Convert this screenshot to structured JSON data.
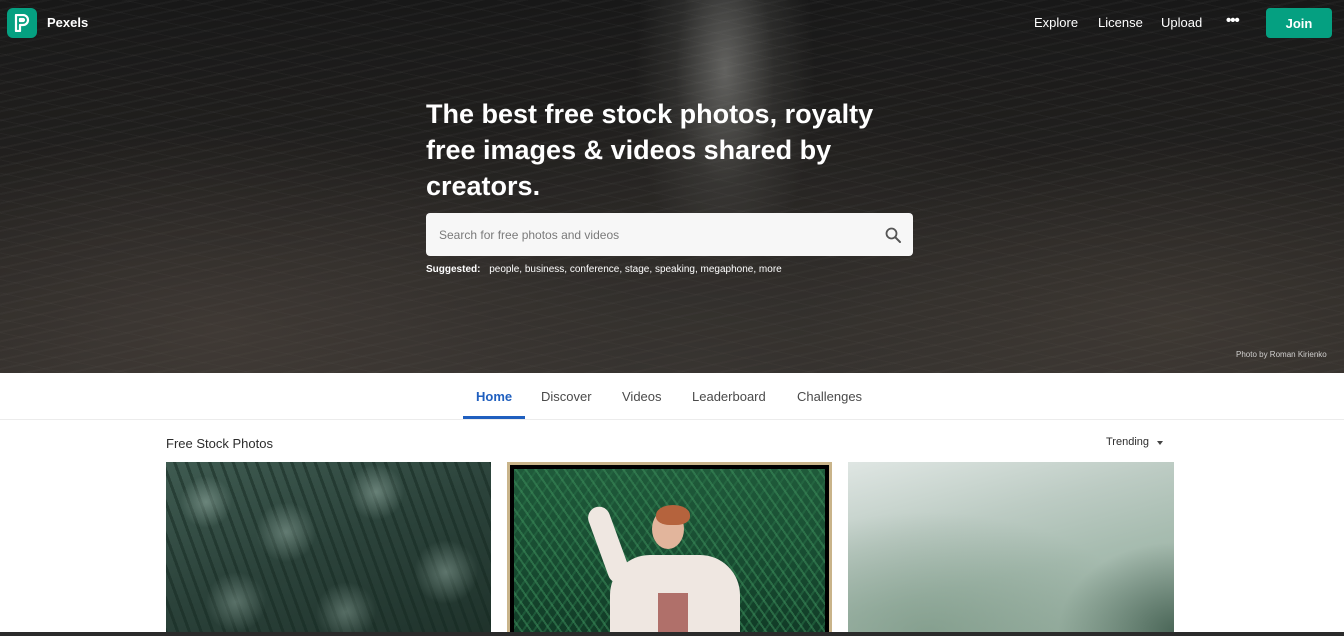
{
  "brand": {
    "name": "Pexels",
    "accent": "#05a081"
  },
  "nav": {
    "links": [
      "Explore",
      "License",
      "Upload"
    ],
    "more_label": "•••",
    "join_label": "Join"
  },
  "hero": {
    "headline": "The best free stock photos, royalty free images & videos shared by creators.",
    "search_placeholder": "Search for free photos and videos",
    "suggested_label": "Suggested:",
    "suggestions": [
      "people",
      "business",
      "conference",
      "stage",
      "speaking",
      "megaphone",
      "more"
    ],
    "credit": "Photo by Roman Kirienko"
  },
  "tabs": {
    "items": [
      "Home",
      "Discover",
      "Videos",
      "Leaderboard",
      "Challenges"
    ],
    "active": "Home",
    "active_color": "#1f5fbf"
  },
  "gallery": {
    "title": "Free Stock Photos",
    "sort_label": "Trending"
  }
}
